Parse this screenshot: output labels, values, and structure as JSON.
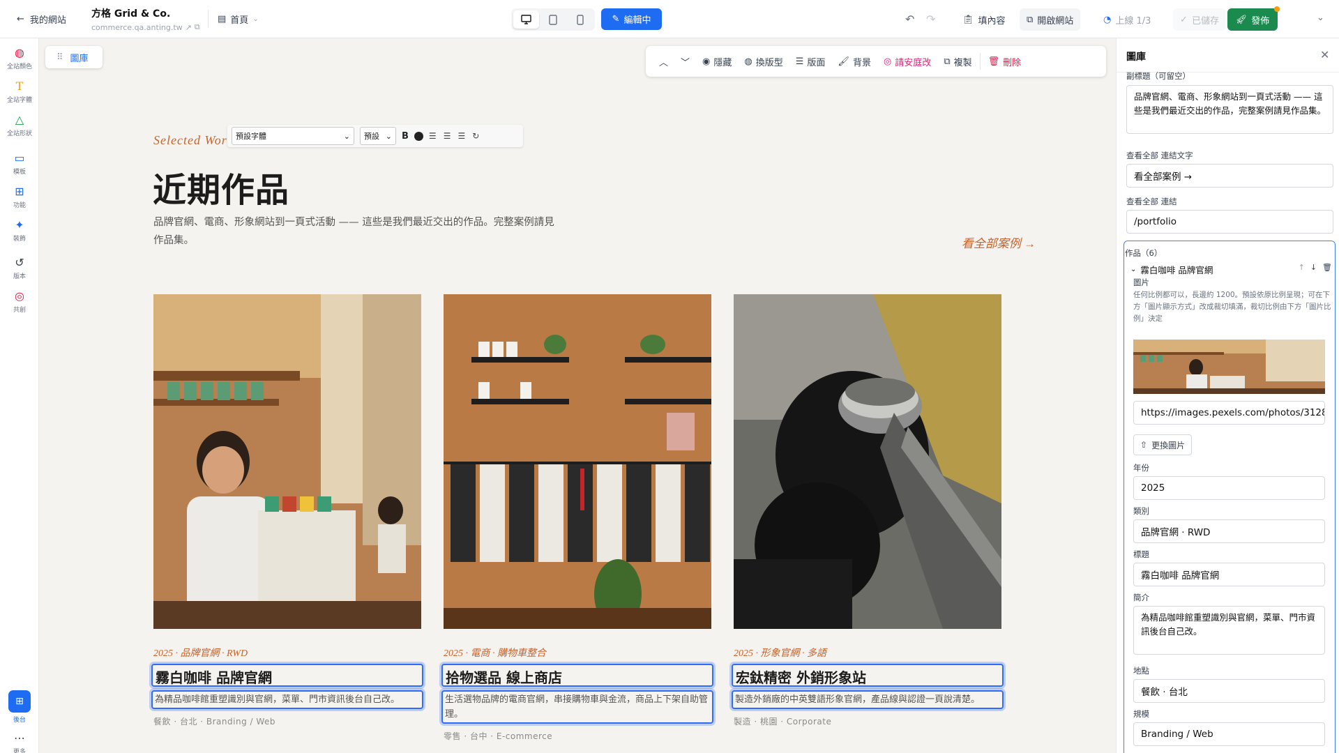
{
  "topbar": {
    "back_label": "我的網站",
    "site_name": "方格 Grid & Co.",
    "site_url": "commerce.qa.anting.tw",
    "page_label": "首頁",
    "edit_label": "編輯中",
    "fill_label": "填內容",
    "open_label": "開啟網站",
    "upload_label": "上線 1/3",
    "saved_label": "已儲存",
    "publish_label": "發佈"
  },
  "leftbar": {
    "items": [
      {
        "icon": "palette-icon",
        "label": "全站顏色",
        "color": "#e11d48"
      },
      {
        "icon": "text-icon",
        "label": "全站字體",
        "color": "#f59e0b"
      },
      {
        "icon": "shapes-icon",
        "label": "全站形狀",
        "color": "#16a34a"
      },
      {
        "icon": "template-icon",
        "label": "模板",
        "color": "#1d6cf2"
      },
      {
        "icon": "blocks-icon",
        "label": "功能",
        "color": "#1d6cf2"
      },
      {
        "icon": "decor-icon",
        "label": "裝飾",
        "color": "#1d6cf2"
      },
      {
        "icon": "history-icon",
        "label": "版本",
        "color": "#374151"
      },
      {
        "icon": "collab-icon",
        "label": "共創",
        "color": "#e11d48"
      }
    ],
    "backend_label": "後台",
    "more_label": "更多"
  },
  "canvas": {
    "library_label": "圖庫",
    "toolbar": {
      "hide": "隱藏",
      "swap": "換版型",
      "layout": "版面",
      "background": "背景",
      "ask": "請安庭改",
      "copy": "複製",
      "delete": "刪除"
    },
    "format_bar": {
      "font": "預設字體",
      "size": "預設",
      "bold": "B"
    },
    "eyebrow": "Selected Wor",
    "title": "近期作品",
    "lede": "品牌官網、電商、形象網站到一頁式活動 —— 這些是我們最近交出的作品。完整案例請見作品集。",
    "view_all": "看全部案例 →",
    "cards": [
      {
        "meta": "2025 · 品牌官網 · RWD",
        "title": "霧白咖啡 品牌官網",
        "desc": "為精品咖啡館重塑識別與官網，菜單、門市資訊後台自己改。",
        "tags": "餐飲 · 台北 · Branding / Web"
      },
      {
        "meta": "2025 · 電商 · 購物車整合",
        "title": "拾物選品 線上商店",
        "desc": "生活選物品牌的電商官網，串接購物車與金流，商品上下架自助管理。",
        "tags": "零售 · 台中 · E-commerce"
      },
      {
        "meta": "2025 · 形象官網 · 多語",
        "title": "宏鈦精密 外銷形象站",
        "desc": "製造外銷廠的中英雙語形象官網，產品線與認證一頁說清楚。",
        "tags": "製造 · 桃園 · Corporate"
      }
    ]
  },
  "panel": {
    "title": "圖庫",
    "subtitle_label": "副標題（可留空）",
    "subtitle_value": "品牌官網、電商、形象網站到一頁式活動 —— 這些是我們最近交出的作品，完整案例請見作品集。",
    "viewall_text_label": "查看全部 連結文字",
    "viewall_text_value": "看全部案例 →",
    "viewall_link_label": "查看全部 連結",
    "viewall_link_value": "/portfolio",
    "works_label": "作品（6）",
    "item_title": "霧白咖啡 品牌官網",
    "image_label": "圖片",
    "image_help": "任何比例都可以，長邊約 1200。預設依原比例呈現；可在下方「圖片顯示方式」改成裁切填滿，裁切比例由下方「圖片比例」決定",
    "image_url": "https://images.pexels.com/photos/3128",
    "replace_label": "更換圖片",
    "year_label": "年份",
    "year_value": "2025",
    "category_label": "類別",
    "category_value": "品牌官網 · RWD",
    "title_label": "標題",
    "title_value": "霧白咖啡 品牌官網",
    "intro_label": "簡介",
    "intro_value": "為精品咖啡館重塑識別與官網，菜單、門市資訊後台自己改。",
    "location_label": "地點",
    "location_value": "餐飲 · 台北",
    "scale_label": "規模",
    "scale_value": "Branding / Web"
  }
}
